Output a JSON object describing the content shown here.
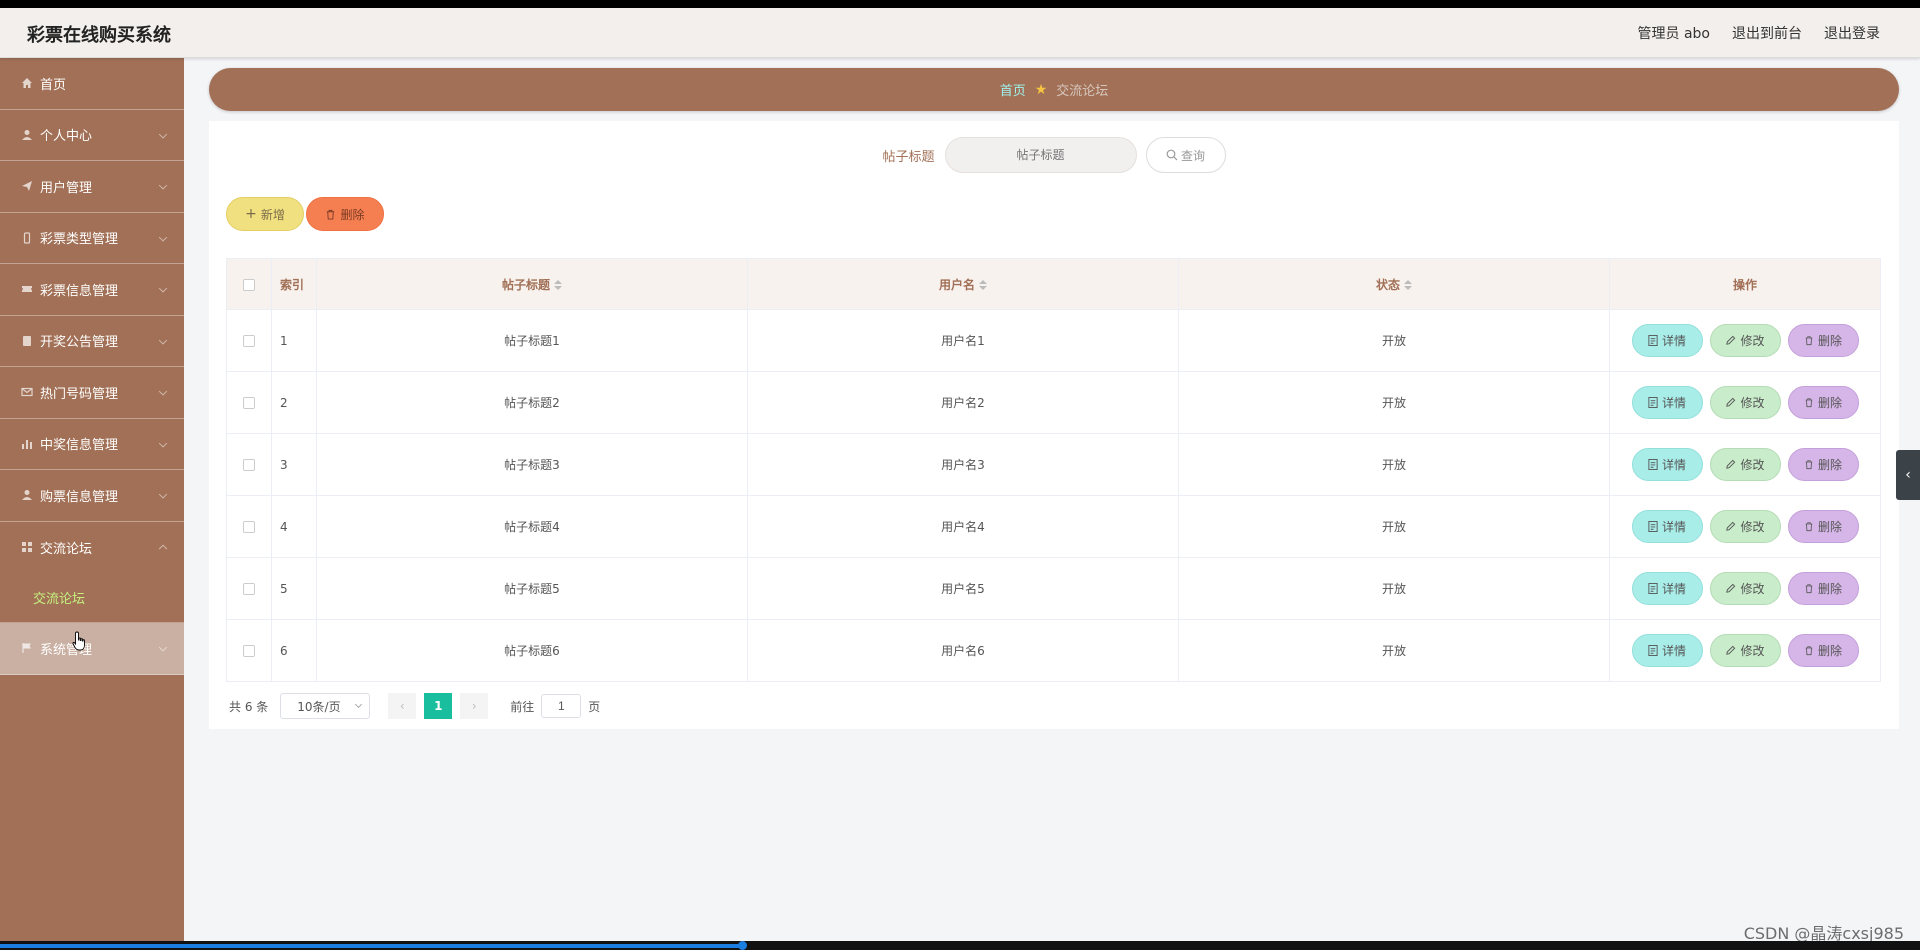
{
  "header": {
    "app_title": "彩票在线购买系统",
    "admin_label": "管理员 abo",
    "back_to_front": "退出到前台",
    "logout": "退出登录"
  },
  "sidebar": {
    "items": [
      {
        "label": "首页",
        "icon": "home-icon"
      },
      {
        "label": "个人中心",
        "icon": "user-icon"
      },
      {
        "label": "用户管理",
        "icon": "send-icon"
      },
      {
        "label": "彩票类型管理",
        "icon": "mobile-icon"
      },
      {
        "label": "彩票信息管理",
        "icon": "ticket-icon"
      },
      {
        "label": "开奖公告管理",
        "icon": "doc-icon"
      },
      {
        "label": "热门号码管理",
        "icon": "mail-icon"
      },
      {
        "label": "中奖信息管理",
        "icon": "chart-icon"
      },
      {
        "label": "购票信息管理",
        "icon": "person-icon"
      },
      {
        "label": "交流论坛",
        "icon": "grid-icon"
      },
      {
        "label": "系统管理",
        "icon": "flag-icon"
      }
    ],
    "submenu_forum": "交流论坛"
  },
  "breadcrumb": {
    "home": "首页",
    "current": "交流论坛"
  },
  "search": {
    "label": "帖子标题",
    "placeholder": "帖子标题",
    "button": "查询"
  },
  "actions": {
    "add": "新增",
    "delete": "删除"
  },
  "table": {
    "columns": [
      "索引",
      "帖子标题",
      "用户名",
      "状态",
      "操作"
    ],
    "rows": [
      {
        "index": "1",
        "title": "帖子标题1",
        "user": "用户名1",
        "status": "开放"
      },
      {
        "index": "2",
        "title": "帖子标题2",
        "user": "用户名2",
        "status": "开放"
      },
      {
        "index": "3",
        "title": "帖子标题3",
        "user": "用户名3",
        "status": "开放"
      },
      {
        "index": "4",
        "title": "帖子标题4",
        "user": "用户名4",
        "status": "开放"
      },
      {
        "index": "5",
        "title": "帖子标题5",
        "user": "用户名5",
        "status": "开放"
      },
      {
        "index": "6",
        "title": "帖子标题6",
        "user": "用户名6",
        "status": "开放"
      }
    ],
    "op_detail": "详情",
    "op_edit": "修改",
    "op_delete": "删除"
  },
  "pagination": {
    "total": "共 6 条",
    "page_size": "10条/页",
    "current_page": "1",
    "goto_prefix": "前往",
    "goto_value": "1",
    "goto_suffix": "页"
  },
  "watermark": "CSDN @晶涛cxsj985",
  "colors": {
    "sidebar": "#a17056",
    "accent": "#18be9e",
    "submenu_active": "#c6f07f"
  }
}
